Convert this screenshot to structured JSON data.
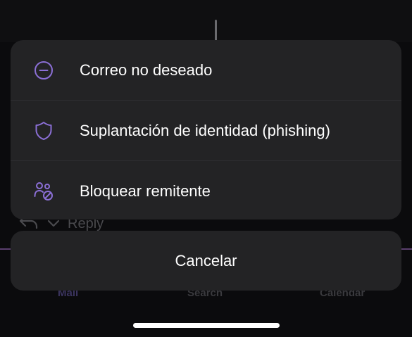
{
  "background": {
    "reply_label": "Reply",
    "tabs": [
      {
        "label": "Mail"
      },
      {
        "label": "Search"
      },
      {
        "label": "Calendar"
      }
    ]
  },
  "sheet": {
    "items": [
      {
        "icon": "minus-circle-icon",
        "label": "Correo no deseado"
      },
      {
        "icon": "shield-icon",
        "label": "Suplantación de identidad (phishing)"
      },
      {
        "icon": "block-person-icon",
        "label": "Bloquear remitente"
      }
    ],
    "cancel_label": "Cancelar"
  },
  "colors": {
    "accent": "#8b6fd6",
    "sheet_bg": "#232325",
    "backdrop": "#0b0b0d"
  }
}
